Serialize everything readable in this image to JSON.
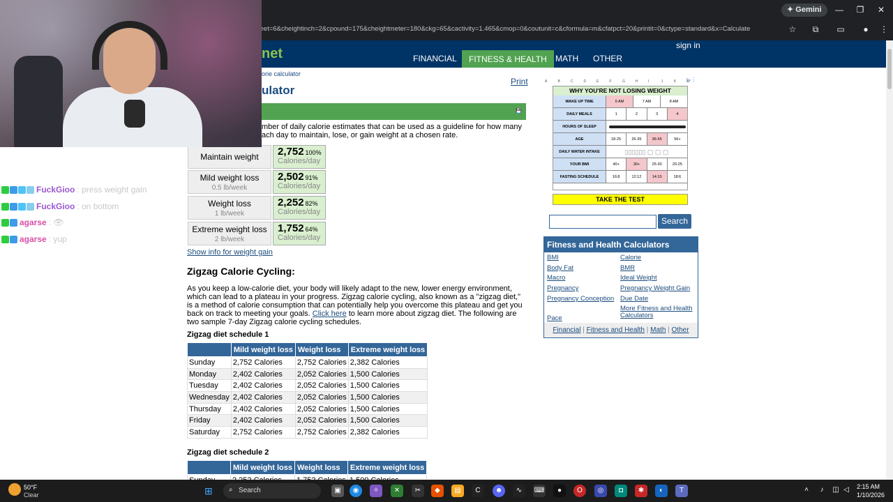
{
  "browser": {
    "gemini_label": "✦ Gemini",
    "url": "feet=6&cheightinch=2&cpound=175&cheightmeter=180&ckg=65&cactivity=1.465&cmop=0&coutunit=c&cformula=m&cfatpct=20&printit=0&ctype=standard&x=Calculate"
  },
  "site": {
    "logo": "net",
    "nav": [
      "FINANCIAL",
      "FITNESS & HEALTH",
      "MATH",
      "OTHER"
    ],
    "signin": "sign in",
    "breadcrumb": "orie calculator",
    "title": "ulator",
    "print": "Print",
    "intro": "mber of daily calorie estimates that can be used as a guideline for how many ach day to maintain, lose, or gain weight at a chosen rate."
  },
  "results": [
    {
      "label": "Maintain weight",
      "sub": "",
      "value": "2,752",
      "pct": "100%",
      "unit": "Calories/day"
    },
    {
      "label": "Mild weight loss",
      "sub": "0.5 lb/week",
      "value": "2,502",
      "pct": "91%",
      "unit": "Calories/day"
    },
    {
      "label": "Weight loss",
      "sub": "1 lb/week",
      "value": "2,252",
      "pct": "82%",
      "unit": "Calories/day"
    },
    {
      "label": "Extreme weight loss",
      "sub": "2 lb/week",
      "value": "1,752",
      "pct": "64%",
      "unit": "Calories/day"
    }
  ],
  "gain_link": "Show info for weight gain",
  "zigzag": {
    "heading": "Zigzag Calorie Cycling:",
    "para_a": "As you keep a low-calorie diet, your body will likely adapt to the new, lower energy environment, which can lead to a plateau in your progress. Zigzag calorie cycling, also known as a \"zigzag diet,\" is a method of calorie consumption that can potentially help you overcome this plateau and get you back on track to meeting your goals.",
    "link": "Click here",
    "para_b": "to learn more about zigzag diet. The following are two sample 7-day Zigzag calorie cycling schedules.",
    "schedule1_title": "Zigzag diet schedule 1",
    "schedule2_title": "Zigzag diet schedule 2",
    "headers": [
      "",
      "Mild weight loss",
      "Weight loss",
      "Extreme weight loss"
    ],
    "schedule1": [
      [
        "Sunday",
        "2,752 Calories",
        "2,752 Calories",
        "2,382 Calories"
      ],
      [
        "Monday",
        "2,402 Calories",
        "2,052 Calories",
        "1,500 Calories"
      ],
      [
        "Tuesday",
        "2,402 Calories",
        "2,052 Calories",
        "1,500 Calories"
      ],
      [
        "Wednesday",
        "2,402 Calories",
        "2,052 Calories",
        "1,500 Calories"
      ],
      [
        "Thursday",
        "2,402 Calories",
        "2,052 Calories",
        "1,500 Calories"
      ],
      [
        "Friday",
        "2,402 Calories",
        "2,052 Calories",
        "1,500 Calories"
      ],
      [
        "Saturday",
        "2,752 Calories",
        "2,752 Calories",
        "2,382 Calories"
      ]
    ],
    "schedule2_first": [
      "Sunday",
      "2,252 Calories",
      "1,752 Calories",
      "1,500 Calories"
    ]
  },
  "ad": {
    "columns": [
      "A",
      "B",
      "C",
      "D",
      "E",
      "F",
      "G",
      "H",
      "I",
      "J",
      "K",
      "M"
    ],
    "title": "WHY YOU'RE NOT LOSING WEIGHT",
    "rows": [
      {
        "label": "WAKE UP TIME",
        "options": [
          "6 AM",
          "7 AM",
          "8 AM"
        ],
        "selected": 0
      },
      {
        "label": "DAILY MEALS",
        "options": [
          "1",
          "2",
          "3",
          "4"
        ],
        "selected": 3
      },
      {
        "label": "HOURS OF SLEEP",
        "options": [],
        "selected": -1
      },
      {
        "label": "AGE",
        "options": [
          "18-25",
          "26-35",
          "36-55",
          "56+"
        ],
        "selected": 2
      },
      {
        "label": "DAILY WATER INTAKE",
        "options": [],
        "selected": -1
      },
      {
        "label": "YOUR BMI",
        "options": [
          "40+",
          "30+",
          "25-30",
          "20-25"
        ],
        "selected": 1
      },
      {
        "label": "FASTING SCHEDULE",
        "options": [
          "16:8",
          "12:12",
          "14:10",
          "18:6"
        ],
        "selected": 2
      }
    ],
    "cta": "TAKE THE TEST"
  },
  "search": {
    "button": "Search",
    "placeholder": ""
  },
  "calcbox": {
    "title": "Fitness and Health Calculators",
    "left": [
      "BMI",
      "Body Fat",
      "Macro",
      "Pregnancy",
      "Pregnancy Conception",
      "Pace"
    ],
    "right": [
      "Calorie",
      "BMR",
      "Ideal Weight",
      "Pregnancy Weight Gain",
      "Due Date",
      "More Fitness and Health Calculators"
    ],
    "footer": [
      "Financial",
      "Fitness and Health",
      "Math",
      "Other"
    ]
  },
  "chat": [
    {
      "user": "FuckGioo",
      "msg": ": press weight gain",
      "color": "#9b59d0"
    },
    {
      "user": "FuckGioo",
      "msg": ": on bottom",
      "color": "#9b59d0"
    },
    {
      "user": "agarse",
      "msg": ": 👁",
      "color": "#d94fa8"
    },
    {
      "user": "agarse",
      "msg": ": yup",
      "color": "#d94fa8"
    }
  ],
  "taskbar": {
    "temp": "50°F",
    "weather": "Clear",
    "search": "Search",
    "time": "2:15 AM",
    "date": "1/10/2026"
  }
}
